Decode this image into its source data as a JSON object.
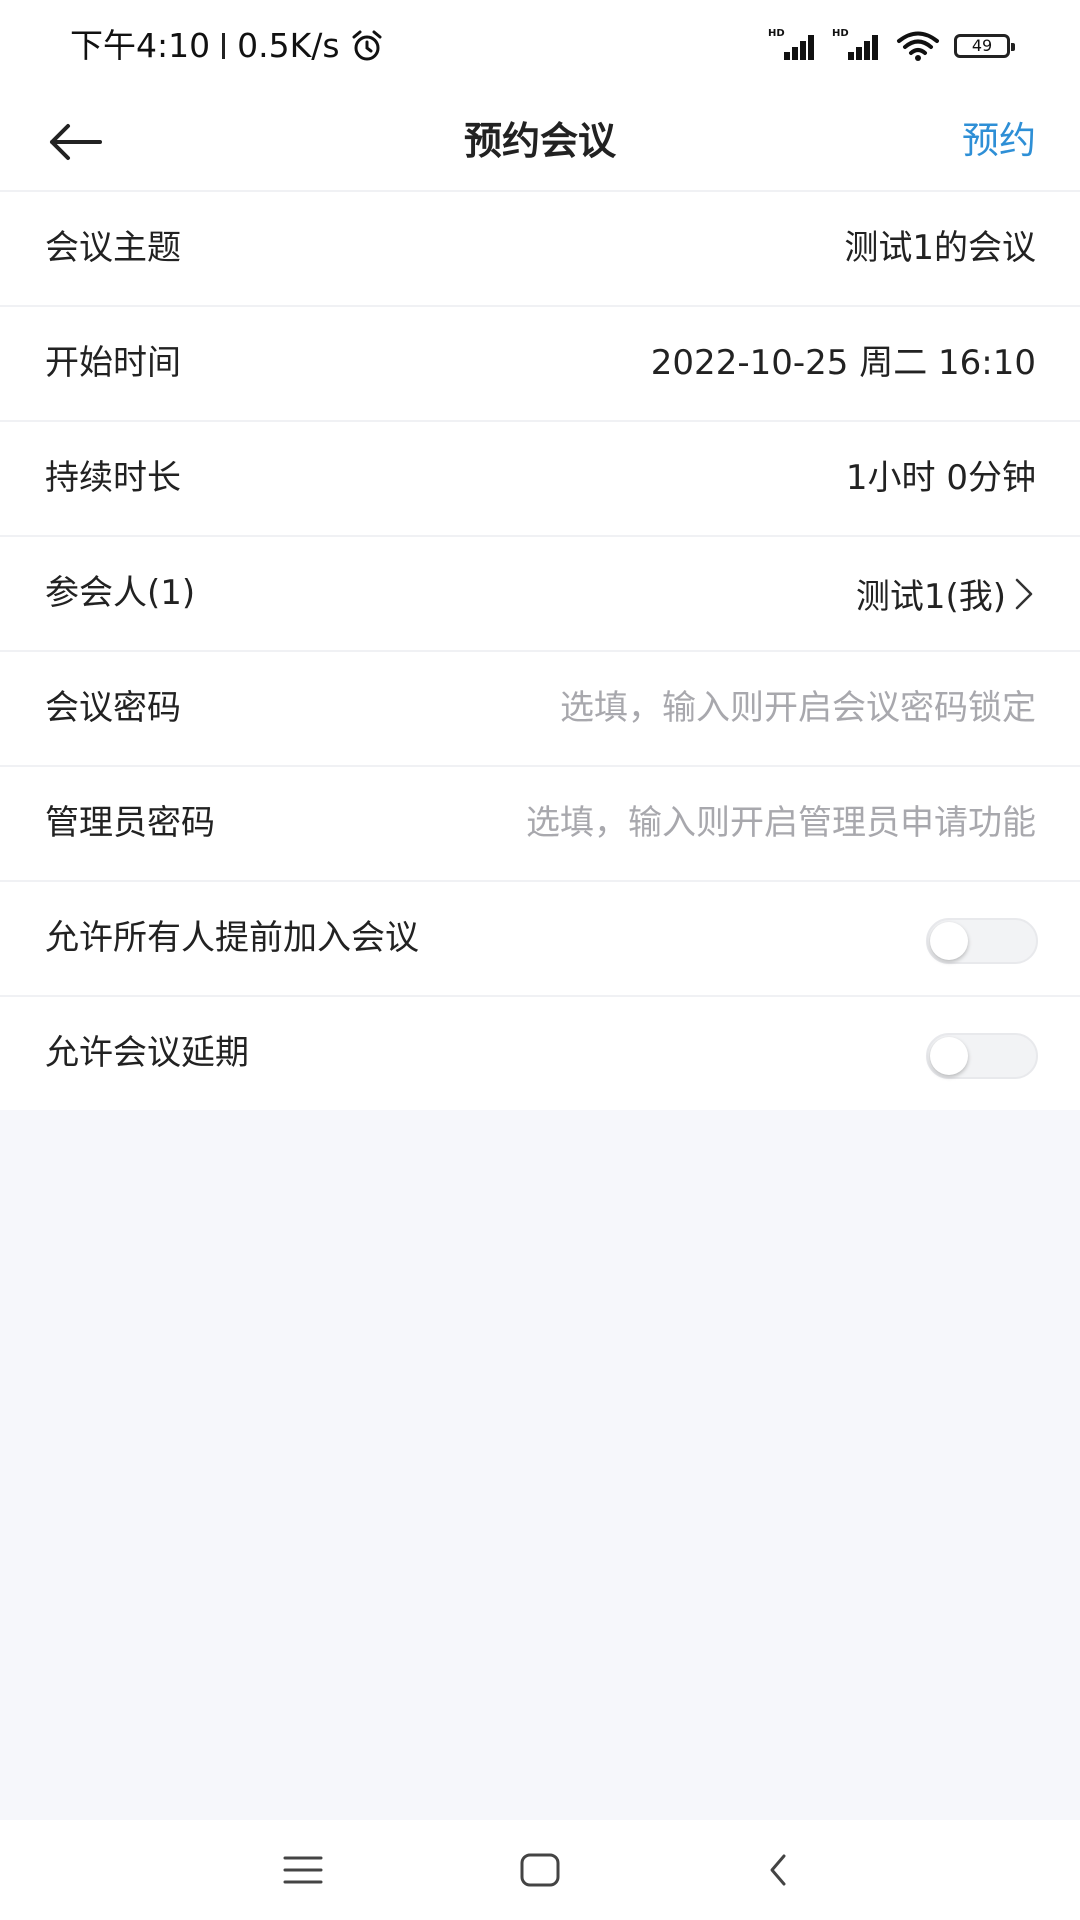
{
  "status_bar": {
    "time": "下午4:10",
    "network_speed": "0.5K/s",
    "battery_level": "49",
    "icons": [
      "alarm-icon",
      "signal-hd-icon",
      "signal-hd-icon",
      "wifi-icon",
      "battery-icon"
    ]
  },
  "header": {
    "title": "预约会议",
    "action_label": "预约",
    "back_icon": "arrow-left-icon",
    "accent_color": "#2e8fd6"
  },
  "form": {
    "rows": [
      {
        "label": "会议主题",
        "value": "测试1的会议"
      },
      {
        "label": "开始时间",
        "value": "2022-10-25 周二 16:10"
      },
      {
        "label": "持续时长",
        "value": "1小时 0分钟"
      },
      {
        "label": "参会人(1)",
        "value": "测试1(我)"
      },
      {
        "label": "会议密码",
        "placeholder": "选填，输入则开启会议密码锁定"
      },
      {
        "label": "管理员密码",
        "placeholder": "选填，输入则开启管理员申请功能"
      }
    ],
    "toggles": [
      {
        "label": "允许所有人提前加入会议",
        "on": false
      },
      {
        "label": "允许会议延期",
        "on": false
      }
    ]
  },
  "nav_bar": {
    "icons": [
      "menu-icon",
      "home-square-icon",
      "back-chevron-icon"
    ]
  }
}
